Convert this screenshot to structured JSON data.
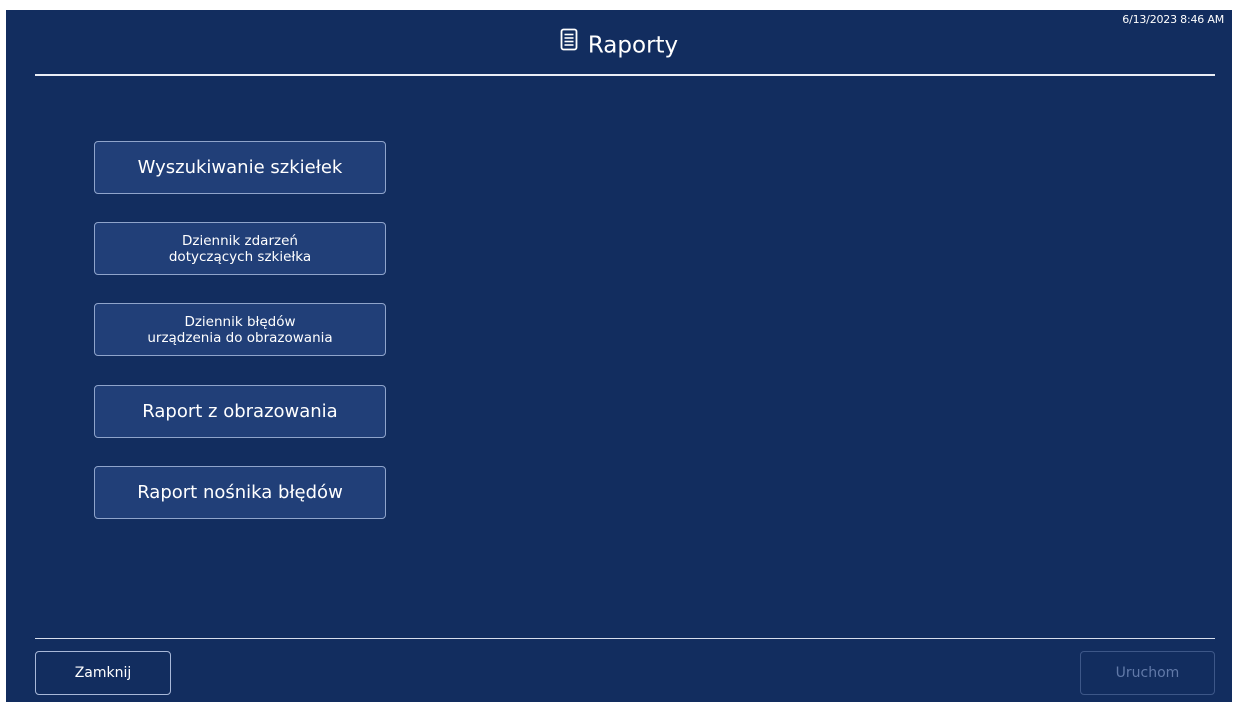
{
  "header": {
    "timestamp": "6/13/2023 8:46 AM",
    "title": "Raporty",
    "title_icon": "report-document-icon"
  },
  "menu": {
    "items": [
      {
        "label": "Wyszukiwanie szkiełek"
      },
      {
        "label": "Dziennik zdarzeń\ndotyczących szkiełka"
      },
      {
        "label": "Dziennik błędów\nurządzenia do obrazowania"
      },
      {
        "label": "Raport z obrazowania"
      },
      {
        "label": "Raport nośnika błędów"
      }
    ]
  },
  "footer": {
    "close_label": "Zamknij",
    "run_label": "Uruchom",
    "run_enabled": false
  },
  "colors": {
    "background": "#122d5f",
    "button_fill": "#213f78",
    "button_border": "#8fa4cb",
    "divider": "#e9edf6",
    "disabled_text": "#6179a8"
  }
}
